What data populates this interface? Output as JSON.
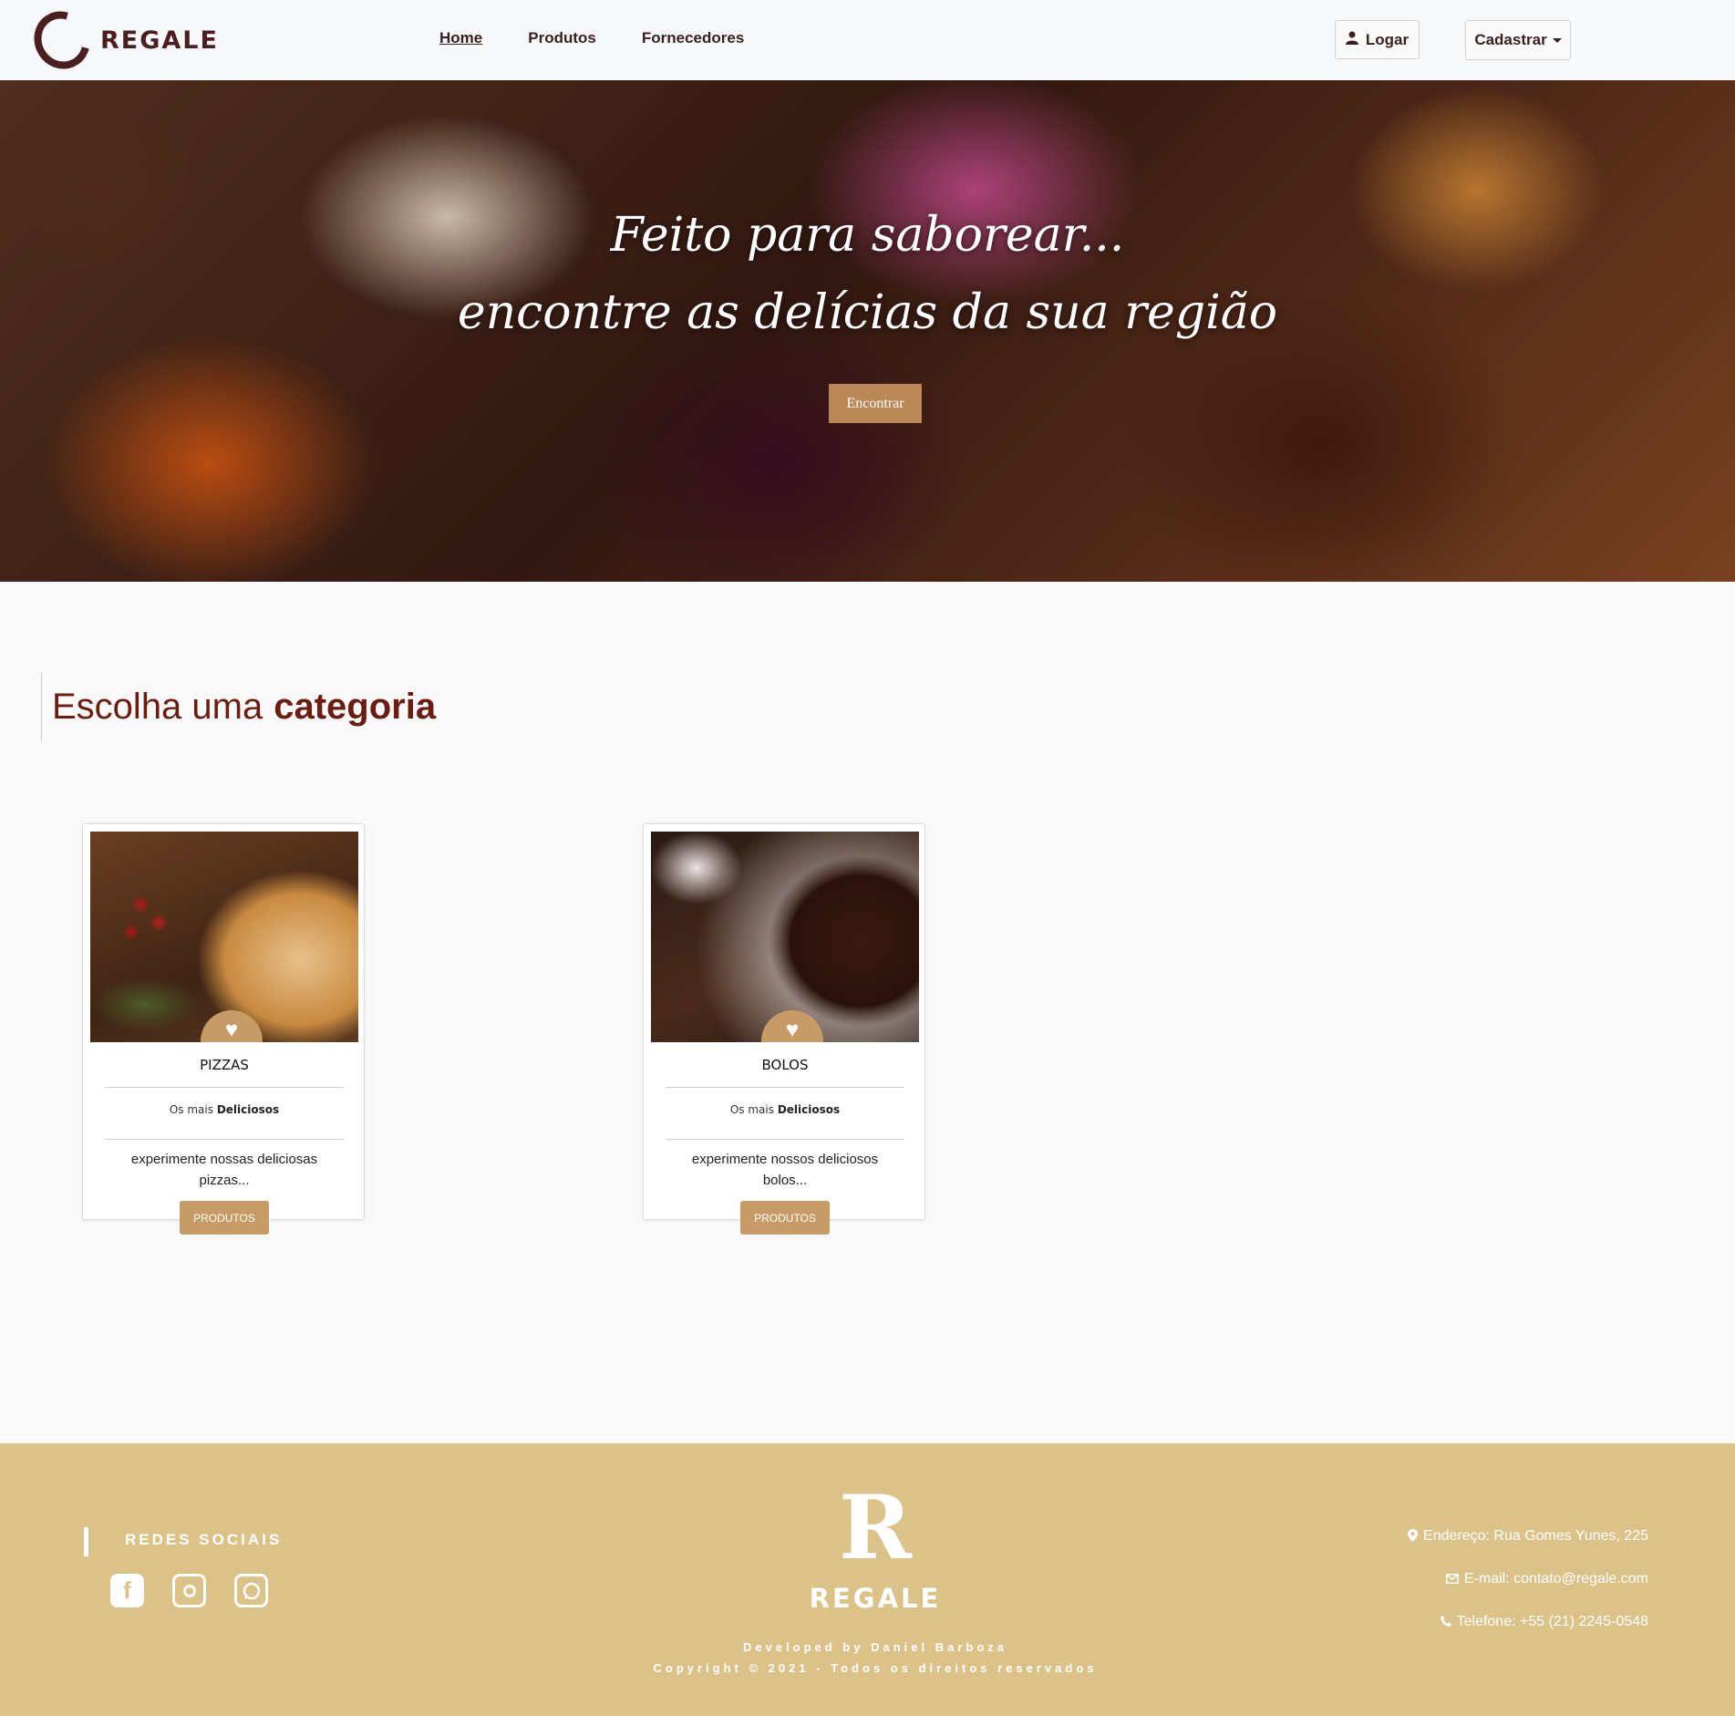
{
  "nav": {
    "brand": "REGALE",
    "links": [
      "Home",
      "Produtos",
      "Fornecedores"
    ],
    "login_label": "Logar",
    "register_label": "Cadastrar"
  },
  "hero": {
    "line1": "Feito para saborear...",
    "line2": "encontre as delícias da sua região",
    "button_label": "Encontrar"
  },
  "section": {
    "title_normal": "Escolha uma",
    "title_bold": "categoria"
  },
  "cards": [
    {
      "name": "PIZZAS",
      "sub_prefix": "Os mais",
      "sub_bold": "Deliciosos",
      "desc": "experimente nossas deliciosas pizzas...",
      "button": "PRODUTOS"
    },
    {
      "name": "BOLOS",
      "sub_prefix": "Os mais",
      "sub_bold": "Deliciosos",
      "desc": "experimente nossos deliciosos bolos...",
      "button": "PRODUTOS"
    }
  ],
  "footer": {
    "social_title": "REDES SOCIAIS",
    "brand_letter": "R",
    "brand": "REGALE",
    "developed": "Developed by Daniel Barboza",
    "copyright": "Copyright © 2021 - Todos os direitos reservados",
    "address": "Endereço: Rua Gomes Yunes, 225",
    "email": "E-mail: contato@regale.com",
    "phone": "Telefone: +55 (21) 2245-0548"
  },
  "colors": {
    "accent": "#c69b66",
    "brand_dark": "#4a1f1f",
    "title_red": "#6b1d12",
    "footer_bg": "#dbc289"
  }
}
